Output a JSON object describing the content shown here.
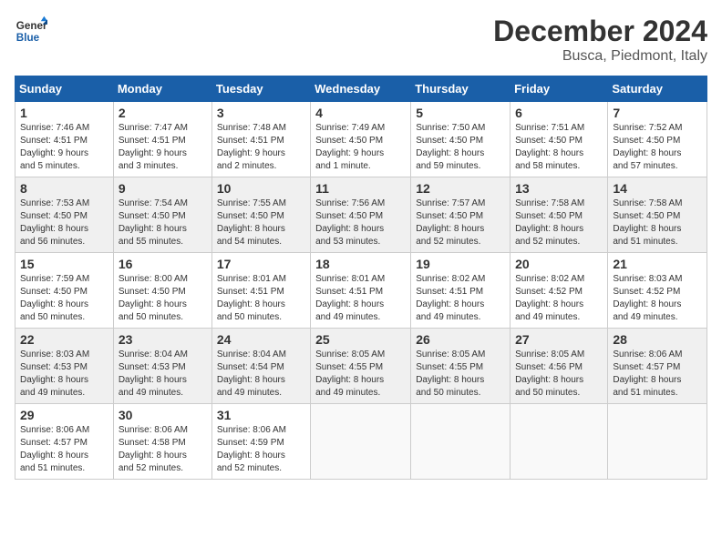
{
  "logo": {
    "text_general": "General",
    "text_blue": "Blue"
  },
  "title": "December 2024",
  "subtitle": "Busca, Piedmont, Italy",
  "days_header": [
    "Sunday",
    "Monday",
    "Tuesday",
    "Wednesday",
    "Thursday",
    "Friday",
    "Saturday"
  ],
  "weeks": [
    [
      {
        "day": "1",
        "info": "Sunrise: 7:46 AM\nSunset: 4:51 PM\nDaylight: 9 hours\nand 5 minutes."
      },
      {
        "day": "2",
        "info": "Sunrise: 7:47 AM\nSunset: 4:51 PM\nDaylight: 9 hours\nand 3 minutes."
      },
      {
        "day": "3",
        "info": "Sunrise: 7:48 AM\nSunset: 4:51 PM\nDaylight: 9 hours\nand 2 minutes."
      },
      {
        "day": "4",
        "info": "Sunrise: 7:49 AM\nSunset: 4:50 PM\nDaylight: 9 hours\nand 1 minute."
      },
      {
        "day": "5",
        "info": "Sunrise: 7:50 AM\nSunset: 4:50 PM\nDaylight: 8 hours\nand 59 minutes."
      },
      {
        "day": "6",
        "info": "Sunrise: 7:51 AM\nSunset: 4:50 PM\nDaylight: 8 hours\nand 58 minutes."
      },
      {
        "day": "7",
        "info": "Sunrise: 7:52 AM\nSunset: 4:50 PM\nDaylight: 8 hours\nand 57 minutes."
      }
    ],
    [
      {
        "day": "8",
        "info": "Sunrise: 7:53 AM\nSunset: 4:50 PM\nDaylight: 8 hours\nand 56 minutes."
      },
      {
        "day": "9",
        "info": "Sunrise: 7:54 AM\nSunset: 4:50 PM\nDaylight: 8 hours\nand 55 minutes."
      },
      {
        "day": "10",
        "info": "Sunrise: 7:55 AM\nSunset: 4:50 PM\nDaylight: 8 hours\nand 54 minutes."
      },
      {
        "day": "11",
        "info": "Sunrise: 7:56 AM\nSunset: 4:50 PM\nDaylight: 8 hours\nand 53 minutes."
      },
      {
        "day": "12",
        "info": "Sunrise: 7:57 AM\nSunset: 4:50 PM\nDaylight: 8 hours\nand 52 minutes."
      },
      {
        "day": "13",
        "info": "Sunrise: 7:58 AM\nSunset: 4:50 PM\nDaylight: 8 hours\nand 52 minutes."
      },
      {
        "day": "14",
        "info": "Sunrise: 7:58 AM\nSunset: 4:50 PM\nDaylight: 8 hours\nand 51 minutes."
      }
    ],
    [
      {
        "day": "15",
        "info": "Sunrise: 7:59 AM\nSunset: 4:50 PM\nDaylight: 8 hours\nand 50 minutes."
      },
      {
        "day": "16",
        "info": "Sunrise: 8:00 AM\nSunset: 4:50 PM\nDaylight: 8 hours\nand 50 minutes."
      },
      {
        "day": "17",
        "info": "Sunrise: 8:01 AM\nSunset: 4:51 PM\nDaylight: 8 hours\nand 50 minutes."
      },
      {
        "day": "18",
        "info": "Sunrise: 8:01 AM\nSunset: 4:51 PM\nDaylight: 8 hours\nand 49 minutes."
      },
      {
        "day": "19",
        "info": "Sunrise: 8:02 AM\nSunset: 4:51 PM\nDaylight: 8 hours\nand 49 minutes."
      },
      {
        "day": "20",
        "info": "Sunrise: 8:02 AM\nSunset: 4:52 PM\nDaylight: 8 hours\nand 49 minutes."
      },
      {
        "day": "21",
        "info": "Sunrise: 8:03 AM\nSunset: 4:52 PM\nDaylight: 8 hours\nand 49 minutes."
      }
    ],
    [
      {
        "day": "22",
        "info": "Sunrise: 8:03 AM\nSunset: 4:53 PM\nDaylight: 8 hours\nand 49 minutes."
      },
      {
        "day": "23",
        "info": "Sunrise: 8:04 AM\nSunset: 4:53 PM\nDaylight: 8 hours\nand 49 minutes."
      },
      {
        "day": "24",
        "info": "Sunrise: 8:04 AM\nSunset: 4:54 PM\nDaylight: 8 hours\nand 49 minutes."
      },
      {
        "day": "25",
        "info": "Sunrise: 8:05 AM\nSunset: 4:55 PM\nDaylight: 8 hours\nand 49 minutes."
      },
      {
        "day": "26",
        "info": "Sunrise: 8:05 AM\nSunset: 4:55 PM\nDaylight: 8 hours\nand 50 minutes."
      },
      {
        "day": "27",
        "info": "Sunrise: 8:05 AM\nSunset: 4:56 PM\nDaylight: 8 hours\nand 50 minutes."
      },
      {
        "day": "28",
        "info": "Sunrise: 8:06 AM\nSunset: 4:57 PM\nDaylight: 8 hours\nand 51 minutes."
      }
    ],
    [
      {
        "day": "29",
        "info": "Sunrise: 8:06 AM\nSunset: 4:57 PM\nDaylight: 8 hours\nand 51 minutes."
      },
      {
        "day": "30",
        "info": "Sunrise: 8:06 AM\nSunset: 4:58 PM\nDaylight: 8 hours\nand 52 minutes."
      },
      {
        "day": "31",
        "info": "Sunrise: 8:06 AM\nSunset: 4:59 PM\nDaylight: 8 hours\nand 52 minutes."
      },
      {
        "day": "",
        "info": ""
      },
      {
        "day": "",
        "info": ""
      },
      {
        "day": "",
        "info": ""
      },
      {
        "day": "",
        "info": ""
      }
    ]
  ]
}
